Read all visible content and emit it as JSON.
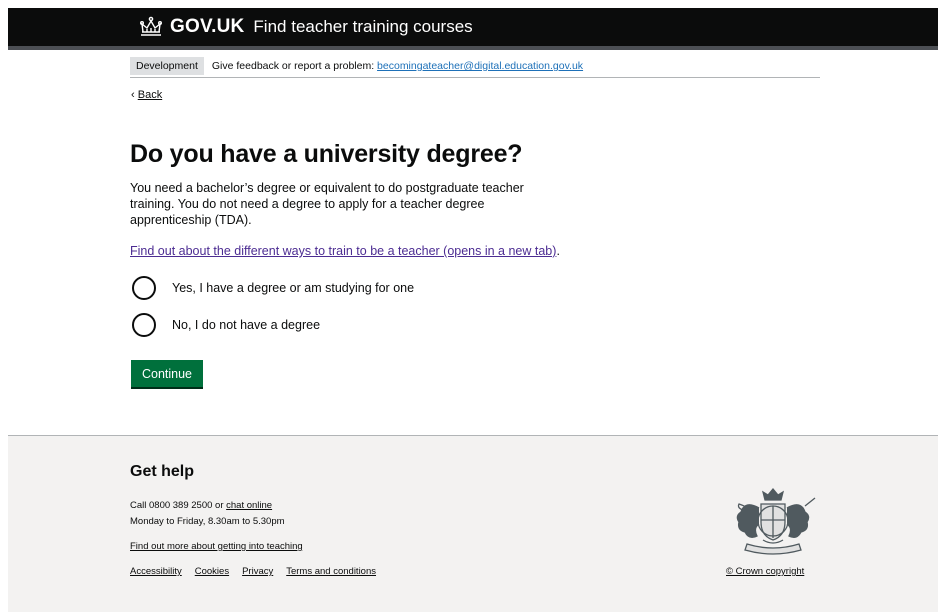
{
  "header": {
    "logo_text": "GOV.UK",
    "service_name": "Find teacher training courses",
    "crown_icon": "crown-icon",
    "bg_color": "#0b0c0c"
  },
  "phase_banner": {
    "tag": "Development",
    "text": "Give feedback or report a problem: ",
    "email": "becomingateacher@digital.education.gov.uk"
  },
  "back_link": {
    "chevron": "‹",
    "label": "Back"
  },
  "main": {
    "title": "Do you have a university degree?",
    "lead": "You need a bachelor’s degree or equivalent to do postgraduate teacher training. You do not need a degree to apply for a teacher degree apprenticeship (TDA).",
    "guide_link": "Find out about the different ways to train to be a teacher (opens in a new tab)",
    "guide_link_suffix": ".",
    "options": [
      {
        "label": "Yes, I have a degree or am studying for one"
      },
      {
        "label": "No, I do not have a degree"
      }
    ],
    "continue_label": "Continue",
    "continue_color": "#00703c"
  },
  "footer": {
    "heading": "Get help",
    "call_text": "Call 0800 389 2500 or ",
    "chat_link": "chat online",
    "hours": "Monday to Friday, 8.30am to 5.30pm",
    "more_link": "Find out more about getting into teaching",
    "links": [
      "Accessibility",
      "Cookies",
      "Privacy",
      "Terms and conditions"
    ],
    "copyright": "© Crown copyright",
    "crest_icon": "royal-coat-of-arms-icon"
  }
}
